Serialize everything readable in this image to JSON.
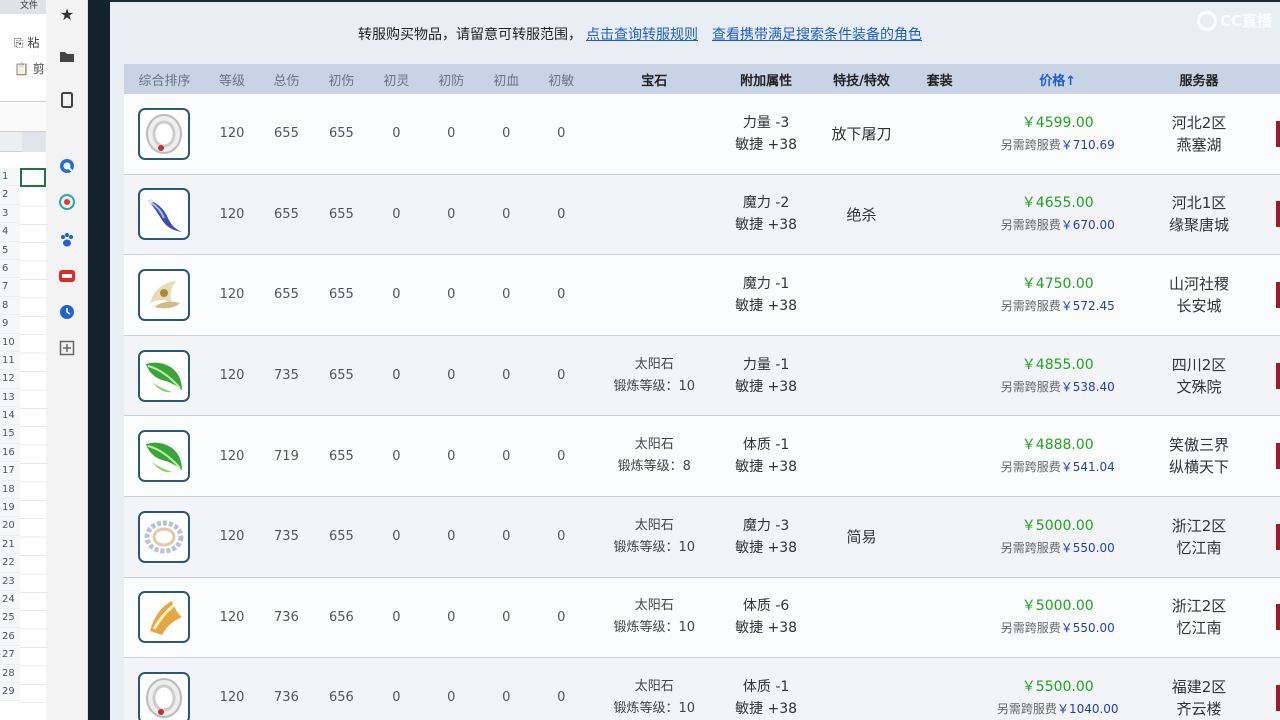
{
  "left_app": {
    "title_fragment": "文件",
    "ribbon_items": [
      "粘",
      "剪"
    ],
    "row_numbers": [
      "1",
      "2",
      "3",
      "4",
      "5",
      "6",
      "7",
      "8",
      "9",
      "10",
      "11",
      "12",
      "13",
      "14",
      "15",
      "16",
      "17",
      "18",
      "19",
      "20",
      "21",
      "22",
      "23",
      "24",
      "25",
      "26",
      "27",
      "28",
      "29"
    ]
  },
  "sidebar_icons": [
    "star-icon",
    "folder-icon",
    "phone-icon",
    "search-q-icon",
    "camera-icon",
    "paw-icon",
    "video-badge-icon",
    "clock-icon",
    "add-box-icon"
  ],
  "logo": {
    "text": "CC直播"
  },
  "notice": {
    "text": "转服购买物品，请留意可转服范围，",
    "link1": "点击查询转服规则",
    "link2": "查看携带满足搜索条件装备的角色"
  },
  "table": {
    "headers": {
      "sort": "综合排序",
      "level": "等级",
      "total": "总伤",
      "base": "初伤",
      "spirit": "初灵",
      "defense": "初防",
      "hp": "初血",
      "agility": "初敏",
      "gem": "宝石",
      "attrs": "附加属性",
      "skill": "特技/特效",
      "suit": "套装",
      "price": "价格↑",
      "server": "服务器"
    },
    "rows": [
      {
        "icon": "ring",
        "level": "120",
        "total": "655",
        "base": "655",
        "spirit": "0",
        "defense": "0",
        "hp": "0",
        "agility": "0",
        "gem1": "",
        "gem2": "",
        "attr1": "力量 -3",
        "attr2": "敏捷 +38",
        "skill": "放下屠刀",
        "suit": "",
        "price": "￥4599.00",
        "extra_label": "另需跨服费",
        "extra": "￥710.69",
        "server1": "河北2区",
        "server2": "燕塞湖"
      },
      {
        "icon": "blade",
        "level": "120",
        "total": "655",
        "base": "655",
        "spirit": "0",
        "defense": "0",
        "hp": "0",
        "agility": "0",
        "gem1": "",
        "gem2": "",
        "attr1": "魔力 -2",
        "attr2": "敏捷 +38",
        "skill": "绝杀",
        "suit": "",
        "price": "￥4655.00",
        "extra_label": "另需跨服费",
        "extra": "￥670.00",
        "server1": "河北1区",
        "server2": "缘聚唐城"
      },
      {
        "icon": "claw",
        "level": "120",
        "total": "655",
        "base": "655",
        "spirit": "0",
        "defense": "0",
        "hp": "0",
        "agility": "0",
        "gem1": "",
        "gem2": "",
        "attr1": "魔力 -1",
        "attr2": "敏捷 +38",
        "skill": "",
        "suit": "",
        "price": "￥4750.00",
        "extra_label": "另需跨服费",
        "extra": "￥572.45",
        "server1": "山河社稷",
        "server2": "长安城"
      },
      {
        "icon": "leaf",
        "level": "120",
        "total": "735",
        "base": "655",
        "spirit": "0",
        "defense": "0",
        "hp": "0",
        "agility": "0",
        "gem1": "太阳石",
        "gem2": "锻炼等级：10",
        "attr1": "力量 -1",
        "attr2": "敏捷 +38",
        "skill": "",
        "suit": "",
        "price": "￥4855.00",
        "extra_label": "另需跨服费",
        "extra": "￥538.40",
        "server1": "四川2区",
        "server2": "文殊院"
      },
      {
        "icon": "leaf",
        "level": "120",
        "total": "719",
        "base": "655",
        "spirit": "0",
        "defense": "0",
        "hp": "0",
        "agility": "0",
        "gem1": "太阳石",
        "gem2": "锻炼等级：8",
        "attr1": "体质 -1",
        "attr2": "敏捷 +38",
        "skill": "",
        "suit": "",
        "price": "￥4888.00",
        "extra_label": "另需跨服费",
        "extra": "￥541.04",
        "server1": "笑傲三界",
        "server2": "纵横天下"
      },
      {
        "icon": "chain",
        "level": "120",
        "total": "735",
        "base": "655",
        "spirit": "0",
        "defense": "0",
        "hp": "0",
        "agility": "0",
        "gem1": "太阳石",
        "gem2": "锻炼等级：10",
        "attr1": "魔力 -3",
        "attr2": "敏捷 +38",
        "skill": "简易",
        "suit": "",
        "price": "￥5000.00",
        "extra_label": "另需跨服费",
        "extra": "￥550.00",
        "server1": "浙江2区",
        "server2": "忆江南"
      },
      {
        "icon": "gold",
        "level": "120",
        "total": "736",
        "base": "656",
        "spirit": "0",
        "defense": "0",
        "hp": "0",
        "agility": "0",
        "gem1": "太阳石",
        "gem2": "锻炼等级：10",
        "attr1": "体质 -6",
        "attr2": "敏捷 +38",
        "skill": "",
        "suit": "",
        "price": "￥5000.00",
        "extra_label": "另需跨服费",
        "extra": "￥550.00",
        "server1": "浙江2区",
        "server2": "忆江南"
      },
      {
        "icon": "ring",
        "level": "120",
        "total": "736",
        "base": "656",
        "spirit": "0",
        "defense": "0",
        "hp": "0",
        "agility": "0",
        "gem1": "太阳石",
        "gem2": "锻炼等级：10",
        "attr1": "体质 -1",
        "attr2": "敏捷 +38",
        "skill": "",
        "suit": "",
        "price": "￥5500.00",
        "extra_label": "另需跨服费",
        "extra": "￥1040.00",
        "server1": "福建2区",
        "server2": "齐云楼"
      }
    ]
  }
}
